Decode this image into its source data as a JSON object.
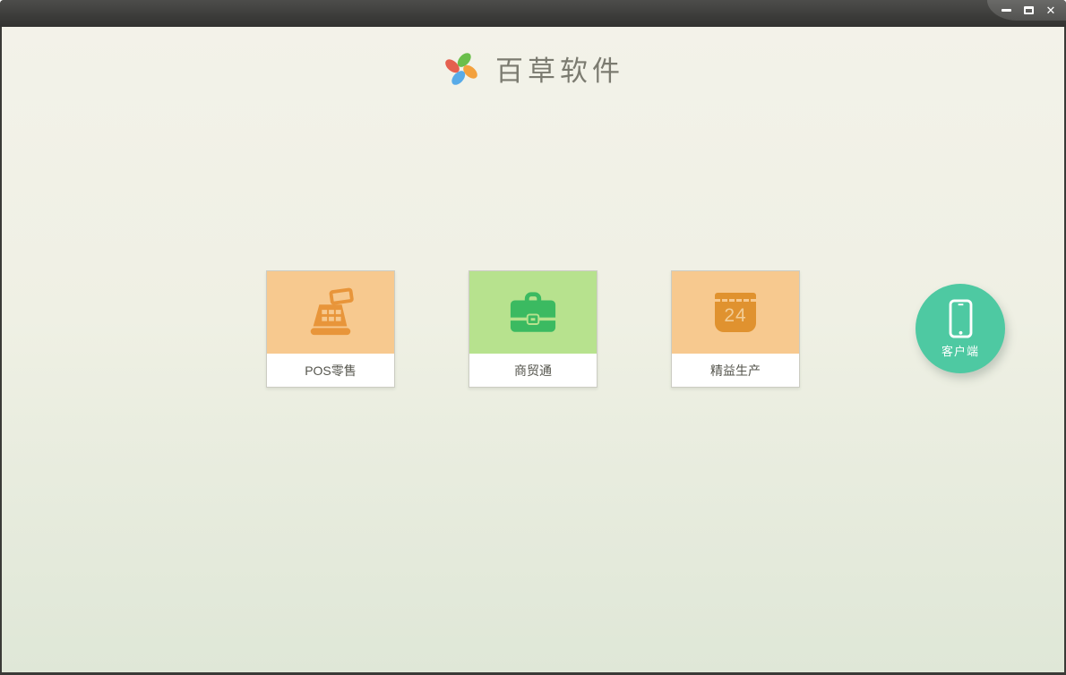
{
  "window": {
    "controls": {
      "minimize_name": "minimize",
      "maximize_name": "maximize",
      "close_glyph": "✕"
    }
  },
  "brand": {
    "title": "百草软件",
    "logo_icon": "pinwheel-icon",
    "logo_colors": {
      "top": "#6abf4b",
      "right": "#f3a13d",
      "bottom": "#58abe8",
      "left": "#e5604f"
    }
  },
  "products": [
    {
      "label": "POS零售",
      "icon": "cash-register-icon",
      "bg": "#f7c98f",
      "icon_color": "#e8953a"
    },
    {
      "label": "商贸通",
      "icon": "briefcase-icon",
      "bg": "#b7e28e",
      "icon_color": "#3bba61"
    },
    {
      "label": "精益生产",
      "icon": "calendar-24-icon",
      "bg": "#f7c98f",
      "icon_color": "#e0922f",
      "day": "24"
    }
  ],
  "client": {
    "label": "客户端",
    "icon": "smartphone-icon",
    "bg": "#4ec9a2"
  },
  "colors": {
    "titlebar_top": "#4d4d4b",
    "titlebar_bottom": "#323230",
    "frame": "#3a3a37",
    "bg_top": "#f3f2e9",
    "bg_bottom": "#dfe7d7"
  }
}
